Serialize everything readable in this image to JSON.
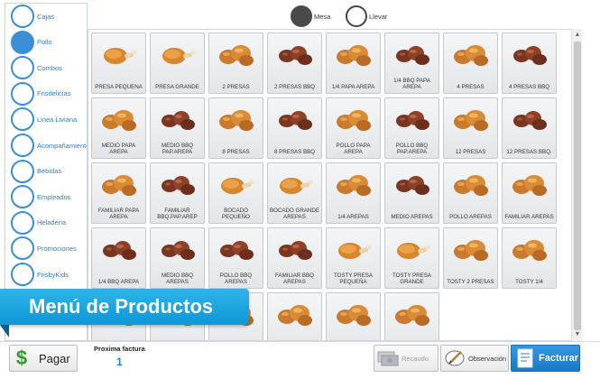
{
  "sidebar": {
    "categories": [
      {
        "label": "Cajas",
        "selected": false
      },
      {
        "label": "Pollo",
        "selected": true
      },
      {
        "label": "Combos",
        "selected": false
      },
      {
        "label": "Frisdelicias",
        "selected": false
      },
      {
        "label": "Linea Liviana",
        "selected": false
      },
      {
        "label": "Acompañamientos",
        "selected": false
      },
      {
        "label": "Bebidas",
        "selected": false
      },
      {
        "label": "Empleados",
        "selected": false
      },
      {
        "label": "Heladeria",
        "selected": false
      },
      {
        "label": "Promociones",
        "selected": false
      },
      {
        "label": "FrisbyKids",
        "selected": false
      }
    ]
  },
  "order_mode": {
    "options": [
      {
        "label": "Mesa",
        "selected": true
      },
      {
        "label": "Llevar",
        "selected": false
      }
    ]
  },
  "products": [
    {
      "name": "PRESA PEQUENA",
      "icon": "chicken-drumstick"
    },
    {
      "name": "PRESA GRANDE",
      "icon": "chicken-drumstick"
    },
    {
      "name": "2 PRESAS",
      "icon": "fried-chicken-pieces"
    },
    {
      "name": "2 PRESAS BBQ",
      "icon": "bbq-chicken-pieces"
    },
    {
      "name": "1/4 PAPA AREPA",
      "icon": "fried-chicken-pieces"
    },
    {
      "name": "1/4 BBQ PAPA AREPA",
      "icon": "bbq-chicken-pieces"
    },
    {
      "name": "4 PRESAS",
      "icon": "fried-chicken-pieces"
    },
    {
      "name": "4 PRESAS BBQ",
      "icon": "bbq-chicken-pieces"
    },
    {
      "name": "MEDIO PAPA AREPA",
      "icon": "fried-chicken-pieces"
    },
    {
      "name": "MEDIO BBQ PAP.AREPA",
      "icon": "bbq-chicken-pieces"
    },
    {
      "name": "8 PRESAS",
      "icon": "fried-chicken-pieces"
    },
    {
      "name": "8 PRESAS BBQ",
      "icon": "bbq-chicken-pieces"
    },
    {
      "name": "POLLO PAPA AREPA",
      "icon": "fried-chicken-pieces"
    },
    {
      "name": "POLLO BBQ PAP.AREPA",
      "icon": "bbq-chicken-pieces"
    },
    {
      "name": "12 PRESAS",
      "icon": "fried-chicken-pieces"
    },
    {
      "name": "12 PRESAS BBQ.",
      "icon": "bbq-chicken-pieces"
    },
    {
      "name": "FAMILIAR PAPA AREPA",
      "icon": "fried-chicken-pieces"
    },
    {
      "name": "FAMILIAR BBQ.PAP.AREP",
      "icon": "bbq-chicken-pieces"
    },
    {
      "name": "BOCADO PEQUEÑO",
      "icon": "chicken-drumstick"
    },
    {
      "name": "BOCADO GRANDE AREPAS",
      "icon": "chicken-drumstick"
    },
    {
      "name": "1/4 AREPAS",
      "icon": "fried-chicken-pieces"
    },
    {
      "name": "MEDIO AREPAS",
      "icon": "bbq-chicken-pieces"
    },
    {
      "name": "POLLO AREPAS",
      "icon": "fried-chicken-pieces"
    },
    {
      "name": "FAMILIAR AREPAS",
      "icon": "fried-chicken-pieces"
    },
    {
      "name": "1/4 BBQ AREPA",
      "icon": "bbq-chicken-pieces"
    },
    {
      "name": "MEDIO BBQ AREPAS",
      "icon": "bbq-chicken-pieces"
    },
    {
      "name": "POLLO BBQ AREPAS",
      "icon": "bbq-chicken-pieces"
    },
    {
      "name": "FAMILIAR BBQ AREPAS",
      "icon": "bbq-chicken-pieces"
    },
    {
      "name": "TOSTY PRESA PEQUEÑA",
      "icon": "chicken-drumstick"
    },
    {
      "name": "TOSTY PRESA GRANDE",
      "icon": "chicken-drumstick"
    },
    {
      "name": "TOSTY 2 PRESAS",
      "icon": "fried-chicken-pieces"
    },
    {
      "name": "TOSTY 1/4",
      "icon": "fried-chicken-pieces"
    },
    {
      "name": "",
      "icon": "fried-chicken-pieces"
    },
    {
      "name": "",
      "icon": "fried-chicken-pieces"
    },
    {
      "name": "",
      "icon": "fried-chicken-pieces"
    },
    {
      "name": "",
      "icon": "fried-chicken-pieces"
    },
    {
      "name": "",
      "icon": "fried-chicken-pieces"
    },
    {
      "name": "",
      "icon": "fried-chicken-pieces"
    }
  ],
  "banner": {
    "text": "Menú de Productos"
  },
  "footer": {
    "pay_label": "Pagar",
    "next_invoice_label": "Proxima factura",
    "next_invoice_number": "1",
    "recaudo_label": "Recaudo",
    "observacion_label": "Observación",
    "facturar_label": "Facturar"
  },
  "colors": {
    "accent": "#3a8fd6",
    "banner": "#1aa6e0",
    "pay_green": "#2e9c2e",
    "facturar": "#1f80d0"
  }
}
